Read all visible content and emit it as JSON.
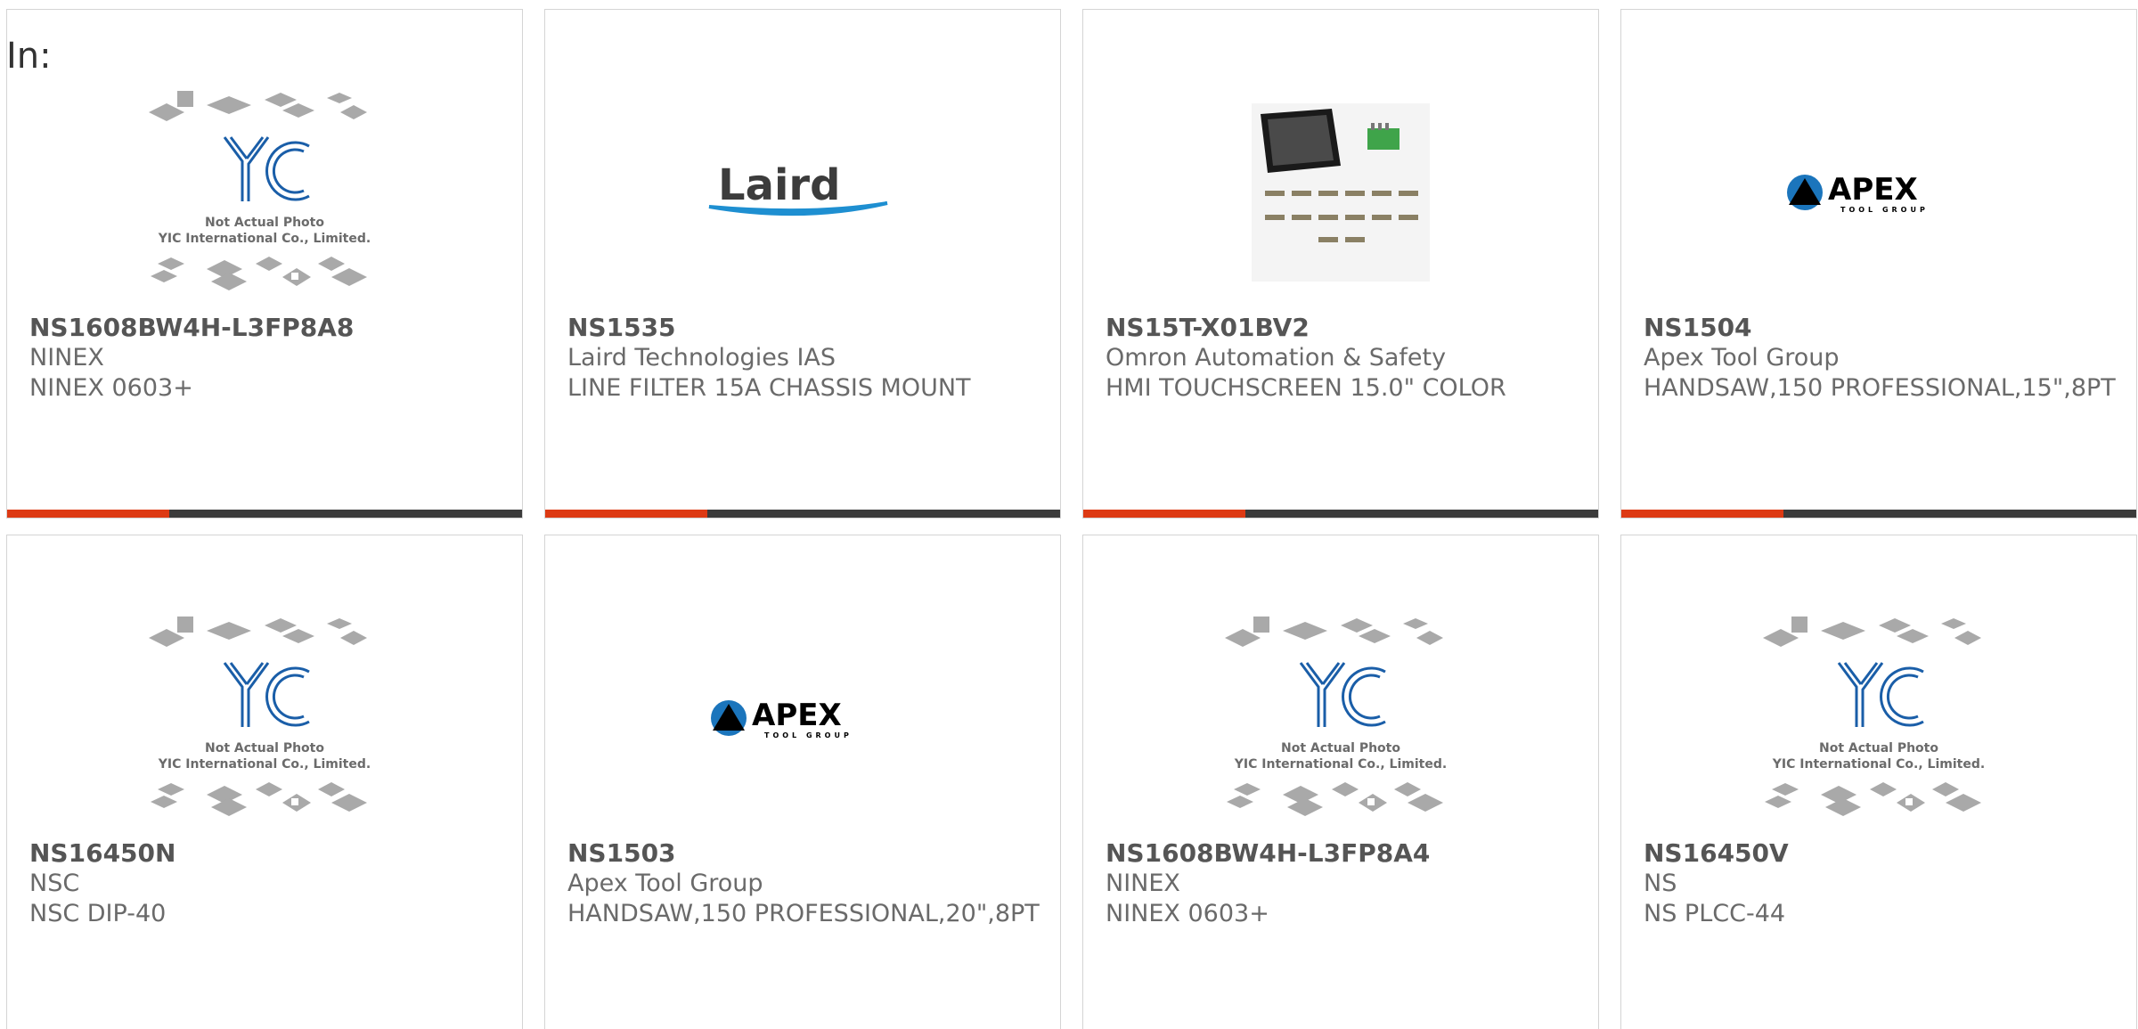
{
  "filter_label": "In:",
  "image_text": {
    "yic_line1": "Not Actual Photo",
    "yic_line2": "YIC International Co., Limited.",
    "laird_logo": "Laird",
    "apex_logo": "APEX",
    "apex_sub": "TOOL GROUP"
  },
  "colors": {
    "accent": "#dd3a14",
    "bar": "#3b3b3b",
    "yic_blue": "#1a5ea8"
  },
  "products": [
    {
      "part": "NS1608BW4H-L3FP8A8",
      "maker": "NINEX",
      "desc": "NINEX 0603+",
      "image": "yic-placeholder-icon"
    },
    {
      "part": "NS1535",
      "maker": "Laird Technologies IAS",
      "desc": "LINE FILTER 15A CHASSIS MOUNT",
      "image": "laird-logo"
    },
    {
      "part": "NS15T-X01BV2",
      "maker": "Omron Automation & Safety",
      "desc": "HMI TOUCHSCREEN 15.0\" COLOR",
      "image": "touchscreen-photo"
    },
    {
      "part": "NS1504",
      "maker": "Apex Tool Group",
      "desc": "HANDSAW,150 PROFESSIONAL,15\",8PT",
      "image": "apex-logo"
    },
    {
      "part": "NS16450N",
      "maker": "NSC",
      "desc": "NSC DIP-40",
      "image": "yic-placeholder-icon"
    },
    {
      "part": "NS1503",
      "maker": "Apex Tool Group",
      "desc": "HANDSAW,150 PROFESSIONAL,20\",8PT",
      "image": "apex-logo"
    },
    {
      "part": "NS1608BW4H-L3FP8A4",
      "maker": "NINEX",
      "desc": "NINEX 0603+",
      "image": "yic-placeholder-icon"
    },
    {
      "part": "NS16450V",
      "maker": "NS",
      "desc": "NS PLCC-44",
      "image": "yic-placeholder-icon"
    }
  ]
}
